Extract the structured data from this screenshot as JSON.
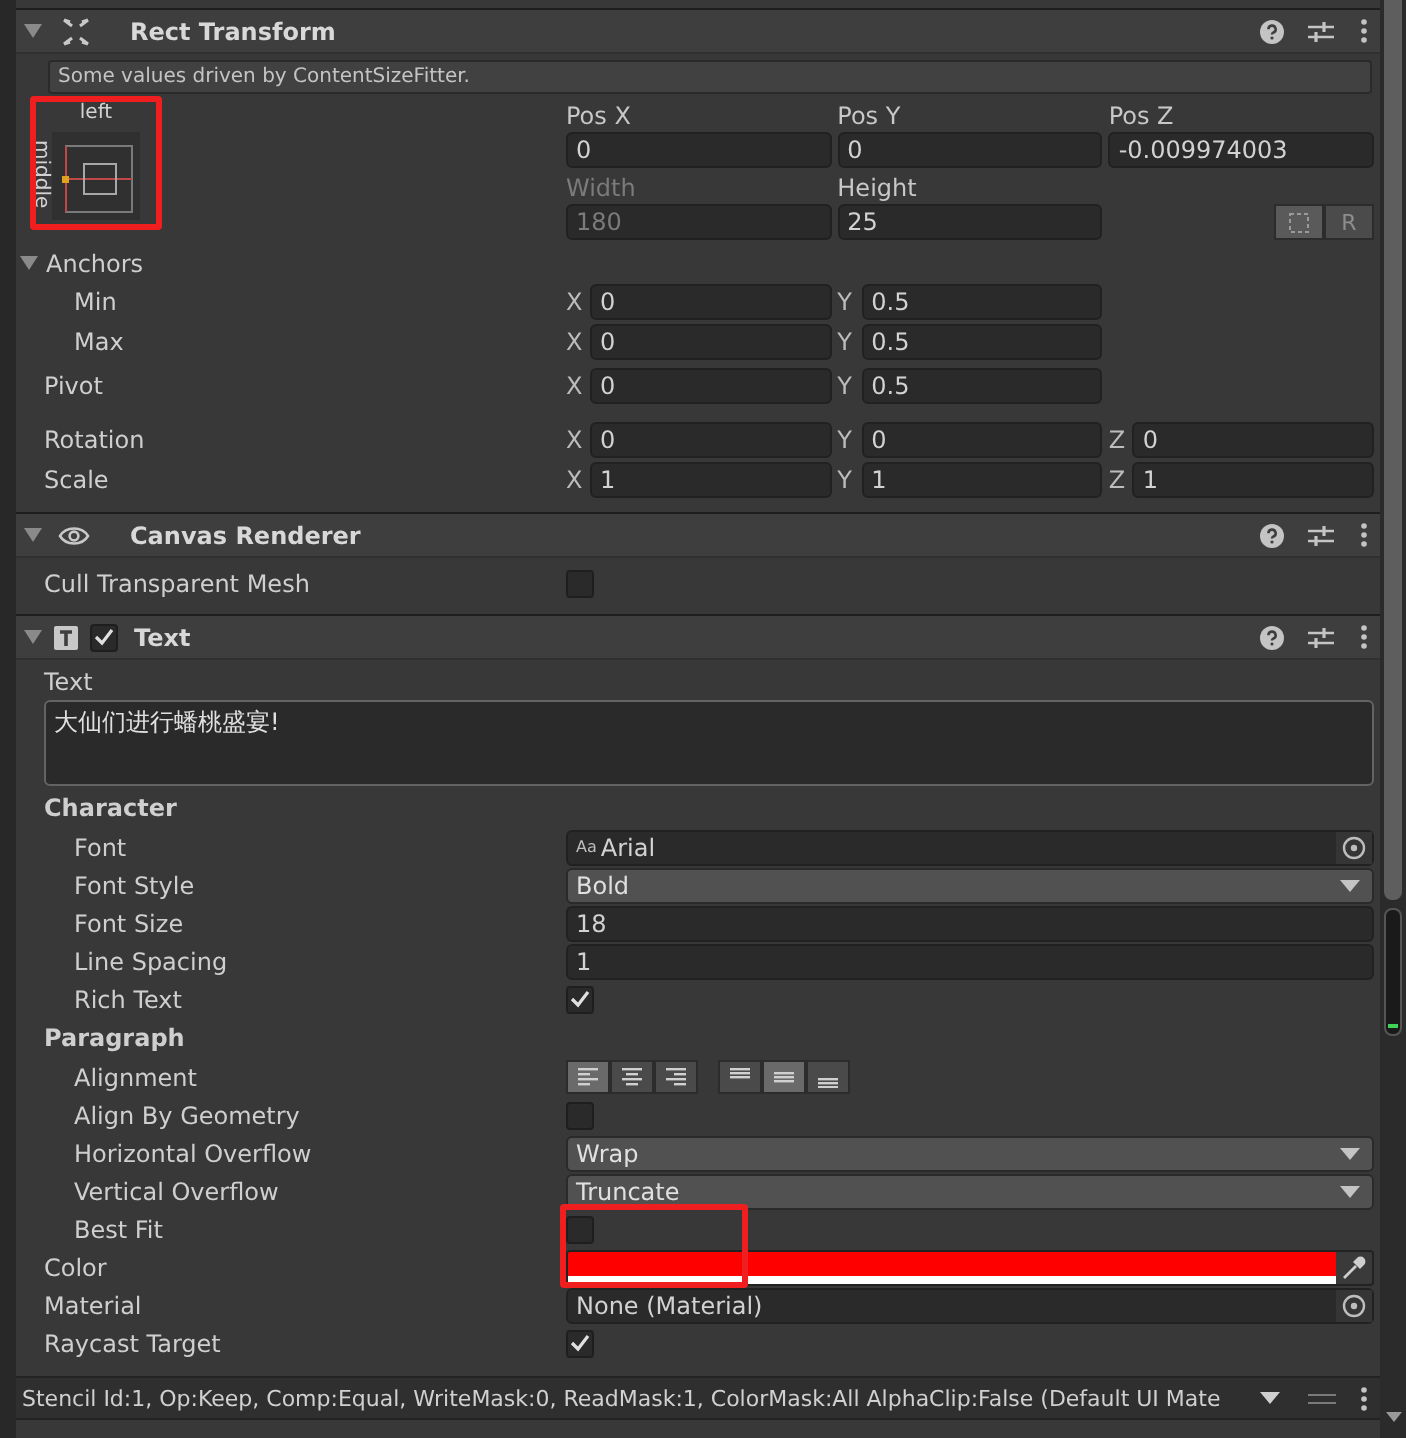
{
  "rect_transform": {
    "title": "Rect Transform",
    "expanded": true,
    "notice": "Some values driven by ContentSizeFitter.",
    "anchor_preset": {
      "horizontal": "left",
      "vertical": "middle"
    },
    "position_fields": [
      {
        "label": "Pos X",
        "value": "0",
        "disabled": false
      },
      {
        "label": "Pos Y",
        "value": "0",
        "disabled": false
      },
      {
        "label": "Pos Z",
        "value": "-0.009974003",
        "disabled": false
      }
    ],
    "size_fields": [
      {
        "label": "Width",
        "value": "180",
        "disabled": true
      },
      {
        "label": "Height",
        "value": "25",
        "disabled": false
      }
    ],
    "raw_button": "R",
    "anchors": {
      "label": "Anchors",
      "expanded": true,
      "rows": [
        {
          "label": "Min",
          "fields": [
            {
              "axis": "X",
              "value": "0"
            },
            {
              "axis": "Y",
              "value": "0.5"
            }
          ]
        },
        {
          "label": "Max",
          "fields": [
            {
              "axis": "X",
              "value": "0"
            },
            {
              "axis": "Y",
              "value": "0.5"
            }
          ]
        }
      ]
    },
    "vector_rows": [
      {
        "label": "Pivot",
        "fields": [
          {
            "axis": "X",
            "value": "0"
          },
          {
            "axis": "Y",
            "value": "0.5"
          }
        ]
      },
      {
        "label": "Rotation",
        "fields": [
          {
            "axis": "X",
            "value": "0"
          },
          {
            "axis": "Y",
            "value": "0"
          },
          {
            "axis": "Z",
            "value": "0"
          }
        ]
      },
      {
        "label": "Scale",
        "fields": [
          {
            "axis": "X",
            "value": "1"
          },
          {
            "axis": "Y",
            "value": "1"
          },
          {
            "axis": "Z",
            "value": "1"
          }
        ]
      }
    ]
  },
  "canvas_renderer": {
    "title": "Canvas Renderer",
    "expanded": true,
    "properties": [
      {
        "kind": "checkbox",
        "label": "Cull Transparent Mesh",
        "checked": false
      }
    ]
  },
  "text_component": {
    "title": "Text",
    "enabled": true,
    "expanded": true,
    "text_label": "Text",
    "text_value": "大仙们进行蟠桃盛宴!",
    "groups": [
      {
        "heading": "Character",
        "properties": [
          {
            "kind": "object",
            "label": "Font",
            "prefix": "Aa",
            "value": "Arial"
          },
          {
            "kind": "dropdown",
            "label": "Font Style",
            "value": "Bold"
          },
          {
            "kind": "number",
            "label": "Font Size",
            "value": "18"
          },
          {
            "kind": "number",
            "label": "Line Spacing",
            "value": "1"
          },
          {
            "kind": "checkbox",
            "label": "Rich Text",
            "checked": true
          }
        ]
      },
      {
        "heading": "Paragraph",
        "properties": [
          {
            "kind": "alignment",
            "label": "Alignment",
            "horizontal": [
              {
                "selected": true
              },
              {
                "selected": false
              },
              {
                "selected": false
              }
            ],
            "vertical": [
              {
                "selected": false
              },
              {
                "selected": true
              },
              {
                "selected": false
              }
            ]
          },
          {
            "kind": "checkbox",
            "label": "Align By Geometry",
            "checked": false
          },
          {
            "kind": "dropdown",
            "label": "Horizontal Overflow",
            "value": "Wrap"
          },
          {
            "kind": "dropdown",
            "label": "Vertical Overflow",
            "value": "Truncate"
          },
          {
            "kind": "checkbox",
            "label": "Best Fit",
            "checked": false
          }
        ]
      }
    ],
    "properties": [
      {
        "kind": "color",
        "label": "Color",
        "color": "#ff0000"
      },
      {
        "kind": "object",
        "label": "Material",
        "value": "None (Material)"
      },
      {
        "kind": "checkbox",
        "label": "Raycast Target",
        "checked": true
      }
    ]
  },
  "status_bar": {
    "text": "Stencil Id:1, Op:Keep, Comp:Equal, WriteMask:0, ReadMask:1, ColorMask:All AlphaClip:False (Default UI Mate"
  }
}
